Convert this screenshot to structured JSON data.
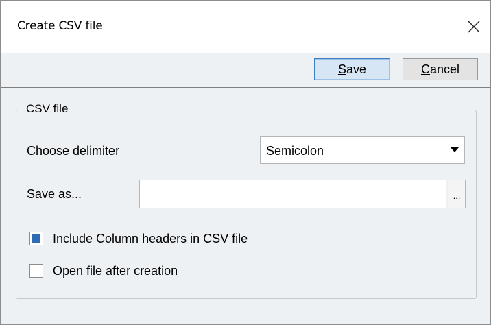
{
  "window": {
    "title": "Create CSV file"
  },
  "toolbar": {
    "save_label": "Save",
    "save_mnemonic": "S",
    "save_rest": "ave",
    "cancel_label": "Cancel",
    "cancel_mnemonic": "C",
    "cancel_rest": "ancel"
  },
  "group": {
    "legend": "CSV file",
    "delimiter_label": "Choose delimiter",
    "delimiter_value": "Semicolon",
    "save_as_label": "Save as...",
    "save_as_value": "",
    "browse_label": "...",
    "include_headers_label": "Include Column headers in CSV file",
    "include_headers_checked": true,
    "open_after_label": "Open file after creation",
    "open_after_checked": false
  },
  "colors": {
    "accent": "#2e6cb4",
    "save_bg": "#d7e6f5",
    "window_bg": "#eef1f4"
  },
  "icons": {
    "close": "close-icon",
    "dropdown": "chevron-down-icon"
  }
}
